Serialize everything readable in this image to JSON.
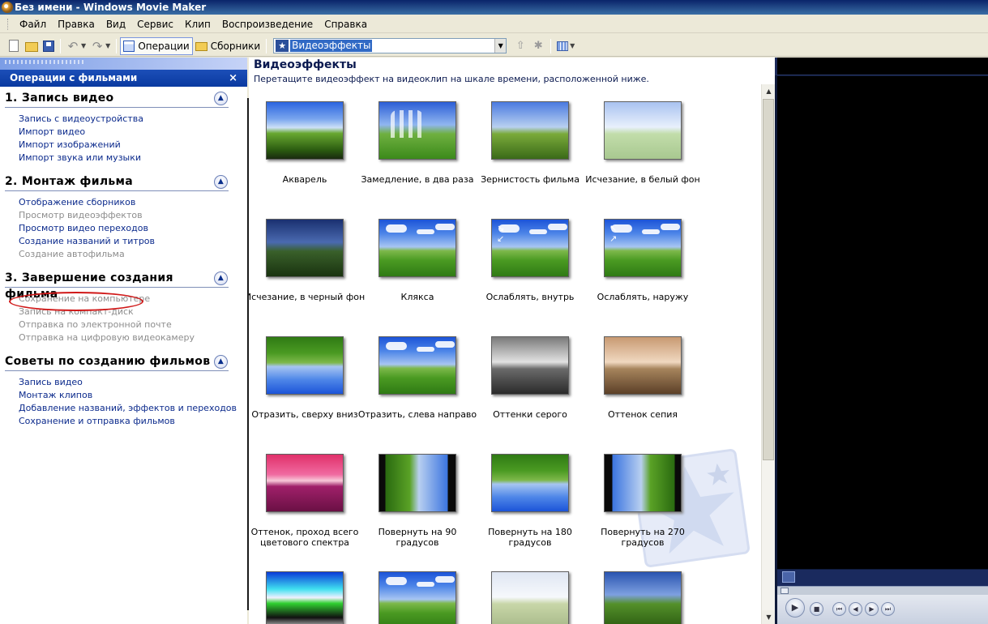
{
  "window": {
    "title": "Без имени - Windows Movie Maker"
  },
  "menu": [
    "Файл",
    "Правка",
    "Вид",
    "Сервис",
    "Клип",
    "Воспроизведение",
    "Справка"
  ],
  "toolbar": {
    "operations_label": "Операции",
    "collections_label": "Сборники",
    "location_value": "Видеоэффекты"
  },
  "task_pane": {
    "title": "Операции с фильмами",
    "close": "×",
    "sections": [
      {
        "title": "1. Запись видео",
        "links": [
          {
            "label": "Запись с видеоустройства",
            "enabled": true
          },
          {
            "label": "Импорт видео",
            "enabled": true
          },
          {
            "label": "Импорт изображений",
            "enabled": true
          },
          {
            "label": "Импорт звука или музыки",
            "enabled": true
          }
        ]
      },
      {
        "title": "2. Монтаж фильма",
        "links": [
          {
            "label": "Отображение сборников",
            "enabled": true
          },
          {
            "label": "Просмотр видеоэффектов",
            "enabled": false
          },
          {
            "label": "Просмотр видео переходов",
            "enabled": true
          },
          {
            "label": "Создание названий и титров",
            "enabled": true
          },
          {
            "label": "Создание автофильма",
            "enabled": false
          }
        ]
      },
      {
        "title": "3. Завершение создания фильма",
        "links": [
          {
            "label": "Сохранение на компьютере",
            "enabled": false
          },
          {
            "label": "Запись на компакт-диск",
            "enabled": false
          },
          {
            "label": "Отправка по электронной почте",
            "enabled": false
          },
          {
            "label": "Отправка на цифровую видеокамеру",
            "enabled": false
          }
        ]
      },
      {
        "title": "Советы по созданию фильмов",
        "links": [
          {
            "label": "Запись видео",
            "enabled": true
          },
          {
            "label": "Монтаж клипов",
            "enabled": true
          },
          {
            "label": "Добавление названий, эффектов и переходов",
            "enabled": true
          },
          {
            "label": "Сохранение и отправка фильмов",
            "enabled": true
          }
        ]
      }
    ]
  },
  "content": {
    "title": "Видеоэффекты",
    "subtitle": "Перетащите видеоэффект на видеоклип на шкале времени, расположенной ниже.",
    "effects": [
      {
        "label": "Акварель",
        "style": "t-watercolor"
      },
      {
        "label": "Замедление, в два раза",
        "style": "t-slow"
      },
      {
        "label": "Зернистость фильма",
        "style": "t-grain"
      },
      {
        "label": "Исчезание, в белый фон",
        "style": "t-white"
      },
      {
        "label": "Исчезание, в черный фон",
        "style": "t-black"
      },
      {
        "label": "Клякса",
        "style": "t-base"
      },
      {
        "label": "Ослаблять, внутрь",
        "style": "t-base"
      },
      {
        "label": "Ослаблять, наружу",
        "style": "t-base"
      },
      {
        "label": "Отразить, сверху вниз",
        "style": "t-flipv"
      },
      {
        "label": "Отразить, слева направо",
        "style": "t-base"
      },
      {
        "label": "Оттенки серого",
        "style": "t-gray"
      },
      {
        "label": "Оттенок сепия",
        "style": "t-sepia"
      },
      {
        "label": "Оттенок, проход всего цветового спектра",
        "style": "t-hue"
      },
      {
        "label": "Повернуть на 90 градусов",
        "style": "t-rot90"
      },
      {
        "label": "Повернуть на 180 градусов",
        "style": "t-flipv"
      },
      {
        "label": "Повернуть на 270 градусов",
        "style": "t-rot270"
      },
      {
        "label": "",
        "style": "t-solar"
      },
      {
        "label": "",
        "style": "t-base"
      },
      {
        "label": "",
        "style": "t-white2"
      },
      {
        "label": "",
        "style": "t-dark2"
      }
    ]
  },
  "colors": {
    "link": "#0b2a8c",
    "disabled": "#8d8d8d",
    "highlight_oval": "#d01818"
  }
}
